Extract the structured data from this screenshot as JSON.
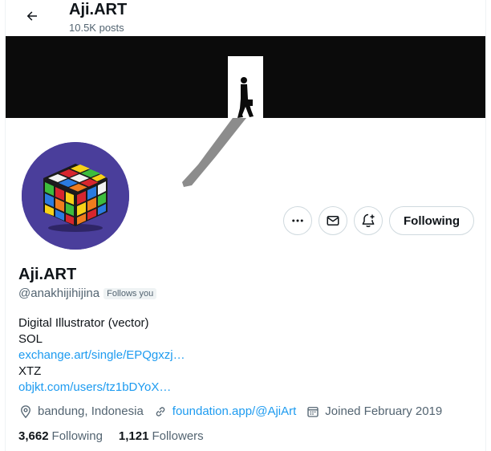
{
  "header": {
    "title": "Aji.ART",
    "posts": "10.5K posts"
  },
  "profile": {
    "name": "Aji.ART",
    "handle": "@anakhijihijina",
    "follows_you": "Follows you",
    "follow_state": "Following",
    "bio_lines": [
      "Digital Illustrator  (vector)",
      "SOL",
      "exchange.art/single/EPQgxzj…",
      "XTZ",
      "objkt.com/users/tz1bDYoX…"
    ],
    "location": "bandung, Indonesia",
    "website": "foundation.app/@AjiArt",
    "joined": "Joined February 2019",
    "following_count": "3,662",
    "following_label": "Following",
    "followers_count": "1,121",
    "followers_label": "Followers"
  },
  "icons": {
    "back": "arrow-left-icon",
    "more": "more-icon",
    "message": "mail-icon",
    "notify": "bell-plus-icon",
    "location": "location-pin-icon",
    "link": "link-icon",
    "calendar": "calendar-icon"
  },
  "colors": {
    "accent": "#1d9bf0",
    "muted": "#536471",
    "avatar_bg": "#4a3e9b",
    "banner_bg": "#0b0b0b"
  }
}
